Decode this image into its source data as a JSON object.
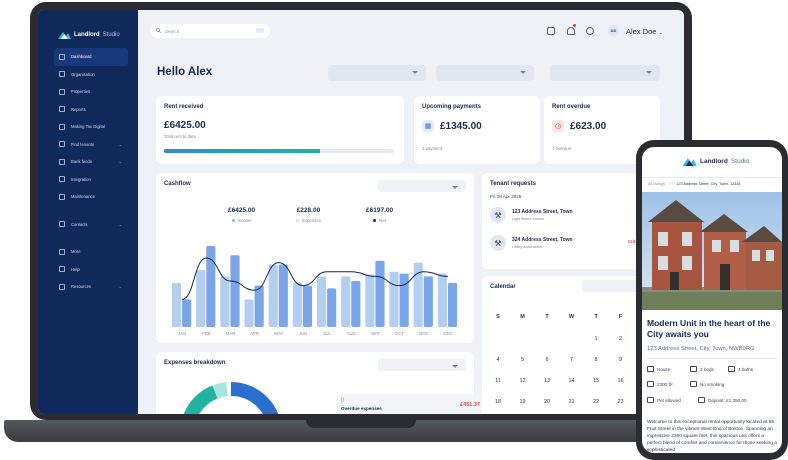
{
  "sidebar": {
    "brand": {
      "name": "Landlord",
      "suffix": "Studio"
    },
    "items": [
      {
        "label": "Dashboard",
        "active": true,
        "chevron": false
      },
      {
        "label": "Organisation",
        "chevron": false
      },
      {
        "label": "Properties",
        "chevron": false
      },
      {
        "label": "Reports",
        "chevron": false
      },
      {
        "label": "Making Tax Digital",
        "chevron": false
      },
      {
        "label": "Find tenants",
        "chevron": true
      },
      {
        "label": "Bank feeds",
        "chevron": true
      },
      {
        "label": "Integration",
        "chevron": false
      },
      {
        "label": "Maintenance",
        "chevron": false
      }
    ],
    "secondary": [
      {
        "label": "Contacts",
        "chevron": true
      }
    ],
    "footer": [
      {
        "label": "More",
        "chevron": false
      },
      {
        "label": "Help",
        "chevron": false
      },
      {
        "label": "Resources",
        "chevron": true
      }
    ]
  },
  "topbar": {
    "search_placeholder": "Search",
    "avatar_initials": "AD",
    "user_name": "Alex Doe"
  },
  "greeting": "Hello Alex",
  "rent_received": {
    "title": "Rent received",
    "amount": "£6425.00",
    "sub": "Total rent to date",
    "progress": 0.68
  },
  "upcoming_payments": {
    "title": "Upcoming payments",
    "amount": "£1345.00",
    "sub": "1 payment"
  },
  "rent_overdue": {
    "title": "Rent overdue",
    "amount": "£623.00",
    "sub": "1 overdue"
  },
  "cashflow": {
    "title": "Cashflow",
    "legend": [
      {
        "value": "£6425.00",
        "label": "Income",
        "color": "#8fb6ee"
      },
      {
        "value": "£228.00",
        "label": "Expenses",
        "color": "#cfe0f8"
      },
      {
        "value": "£6197.00",
        "label": "Net",
        "color": "#0f2a5a"
      }
    ]
  },
  "chart_data": {
    "type": "bar",
    "categories": [
      "JAN",
      "FEB",
      "MAR",
      "APR",
      "MAY",
      "JUN",
      "JUL",
      "AUG",
      "SEP",
      "OCT",
      "NOV",
      "DEC"
    ],
    "series": [
      {
        "name": "Income",
        "values": [
          30,
          88,
          78,
          45,
          68,
          45,
          42,
          50,
          72,
          58,
          55,
          48
        ],
        "color": "#7aa5e8"
      },
      {
        "name": "Expenses",
        "values": [
          48,
          62,
          55,
          30,
          68,
          48,
          55,
          55,
          57,
          60,
          70,
          58
        ],
        "color": "#b4ceef"
      },
      {
        "name": "Net",
        "values": [
          30,
          75,
          50,
          40,
          70,
          45,
          60,
          60,
          55,
          45,
          60,
          55
        ],
        "color": "#0f2a5a"
      }
    ],
    "ylim": [
      0,
      100
    ]
  },
  "expenses": {
    "title": "Expenses breakdown",
    "overdue_label": "Overdue expenses",
    "overdue_amount": "£451.37"
  },
  "tenant_requests": {
    "title": "Tenant requests",
    "date": "Fri 28 Apr 2025",
    "items": [
      {
        "address": "123 Address Street, Town",
        "sub": "Light fixture broken"
      },
      {
        "address": "324 Address Street, Town",
        "sub": "Leaky dishwasher",
        "badge": "Crit"
      }
    ]
  },
  "calendar": {
    "title": "Calendar",
    "weekdays": [
      "S",
      "M",
      "T",
      "W",
      "T",
      "F"
    ],
    "rows": [
      [
        "",
        "",
        "",
        "",
        "1",
        "2"
      ],
      [
        "4",
        "5",
        "6",
        "7",
        "8",
        "9"
      ],
      [
        "11",
        "12",
        "13",
        "14",
        "15",
        "16"
      ],
      [
        "18",
        "19",
        "20",
        "21",
        "22",
        "23"
      ]
    ]
  },
  "phone": {
    "brand": {
      "name": "Landlord",
      "suffix": "Studio"
    },
    "breadcrumb": {
      "root": "All listings",
      "current": "123 Address Street, City, Town, 12345"
    },
    "title": "Modern Unit in the heart of the City awaits you",
    "address": "123 Address Street, City, Town, NWB9RG",
    "features": [
      {
        "label": "House",
        "icon": "house-icon"
      },
      {
        "label": "3 beds",
        "icon": "bed-icon"
      },
      {
        "label": "4 baths",
        "icon": "bath-icon"
      },
      {
        "label": "2300 ft²",
        "icon": "area-icon"
      },
      {
        "label": "No smoking",
        "icon": "no-smoking-icon"
      },
      {
        "label": "Pet allowed",
        "icon": "paw-icon"
      },
      {
        "label": "Deposit: £1,350.00",
        "icon": "deposit-icon"
      }
    ],
    "description": "Welcome to this exceptional rental opportunity located at 55 Fruit Street in the vibrant West End of Boston. Spanning an impressive 2300 square feet, this spacious unit offers a perfect blend of comfort and convenience for those seeking a sophisticated"
  }
}
